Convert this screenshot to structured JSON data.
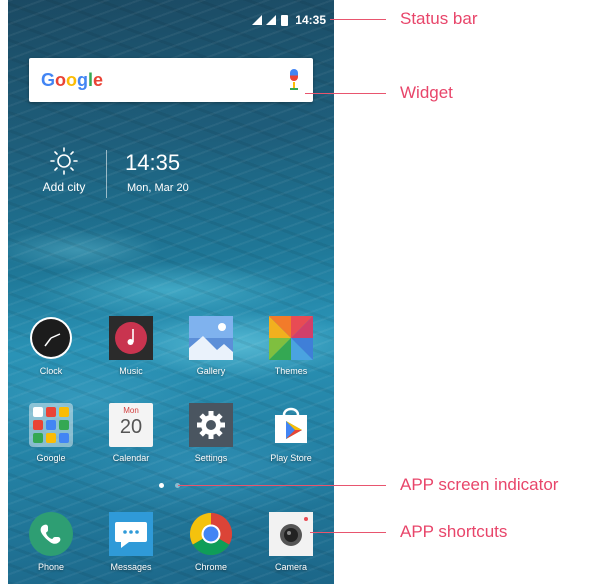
{
  "status_bar": {
    "time": "14:35"
  },
  "widget": {
    "google_letters": [
      {
        "ch": "G",
        "color": "#4285f4"
      },
      {
        "ch": "o",
        "color": "#ea4335"
      },
      {
        "ch": "o",
        "color": "#fbbc05"
      },
      {
        "ch": "g",
        "color": "#4285f4"
      },
      {
        "ch": "l",
        "color": "#34a853"
      },
      {
        "ch": "e",
        "color": "#ea4335"
      }
    ]
  },
  "weather": {
    "city_label": "Add city"
  },
  "clock": {
    "time": "14:35",
    "date": "Mon, Mar 20"
  },
  "apps_row1": [
    "Clock",
    "Music",
    "Gallery",
    "Themes"
  ],
  "apps_row2": [
    "Google",
    "Calendar",
    "Settings",
    "Play Store"
  ],
  "calendar_icon": {
    "day_name": "Mon",
    "day_number": "20"
  },
  "dock": [
    "Phone",
    "Messages",
    "Chrome",
    "Camera"
  ],
  "page_indicator": {
    "pages": 2,
    "current": 1
  },
  "callouts": {
    "status_bar": "Status bar",
    "widget": "Widget",
    "screen_indicator": "APP screen indicator",
    "shortcuts": "APP shortcuts"
  },
  "colors": {
    "callout": "#e8456a"
  }
}
